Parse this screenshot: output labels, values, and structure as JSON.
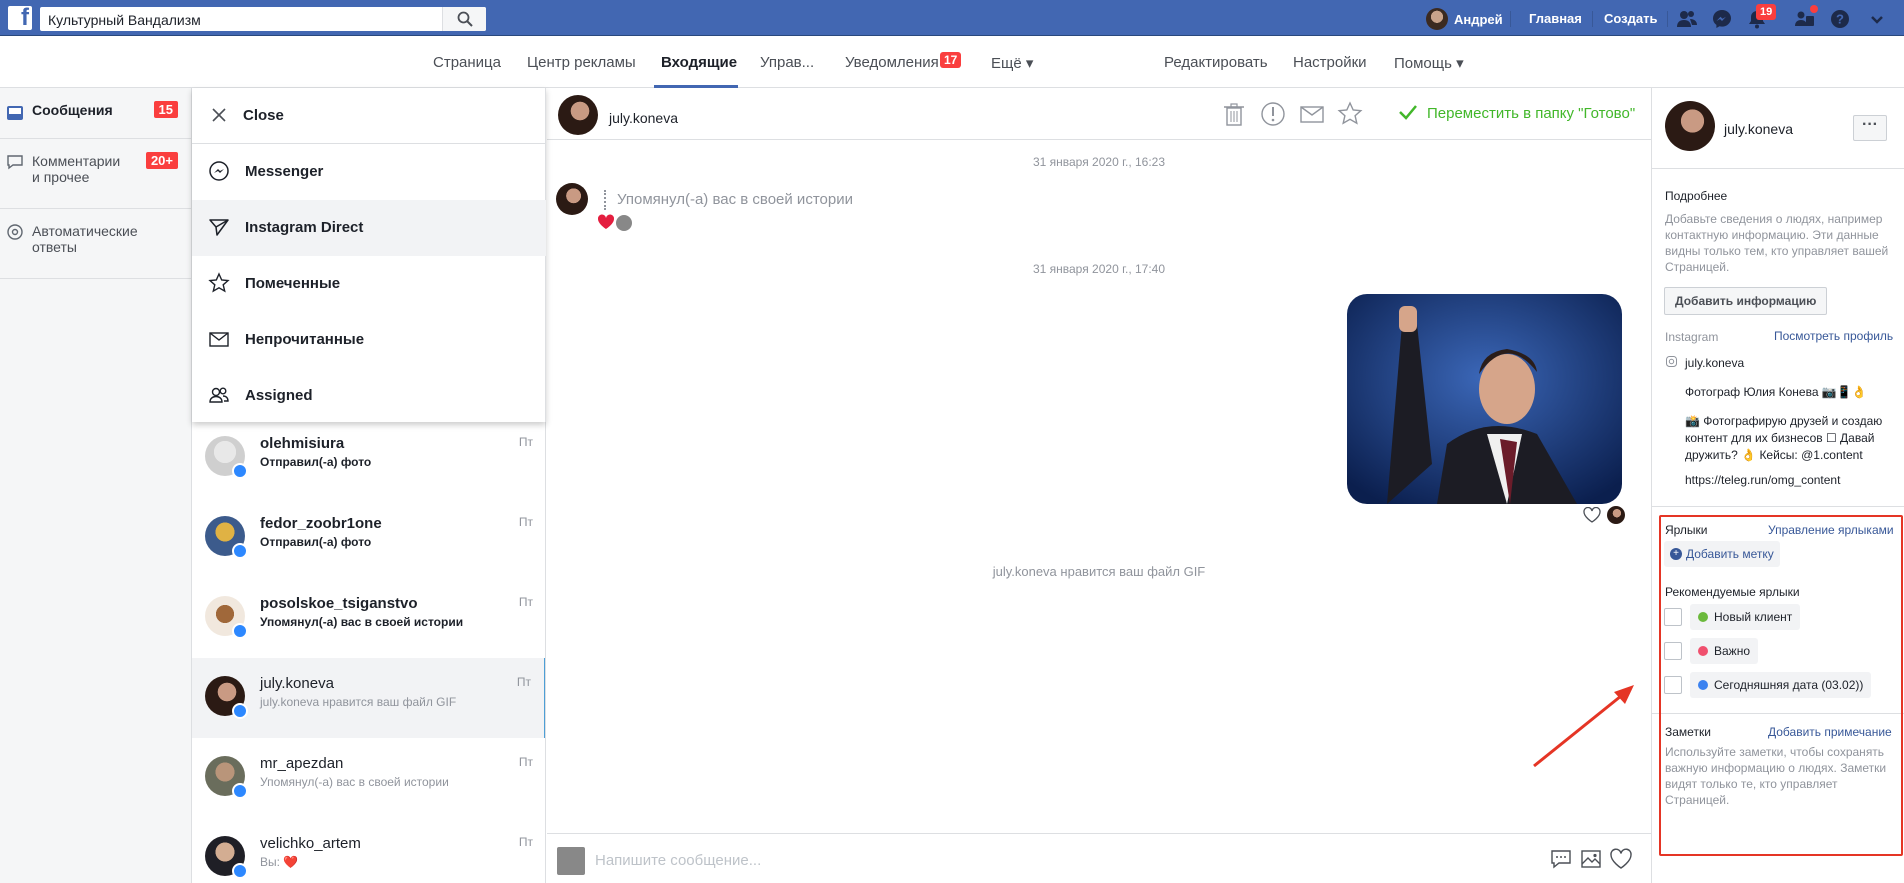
{
  "topbar": {
    "search_value": "Культурный Вандализм",
    "user_name": "Андрей",
    "home_label": "Главная",
    "create_label": "Создать",
    "notifications_count": "19"
  },
  "subnav": {
    "items": [
      "Страница",
      "Центр рекламы",
      "Входящие",
      "Управ...",
      "Уведомления",
      "Ещё ▾"
    ],
    "notifications_badge": "17",
    "right": [
      "Редактировать",
      "Настройки",
      "Помощь ▾"
    ]
  },
  "leftnav": {
    "items": [
      {
        "label": "Сообщения",
        "badge": "15"
      },
      {
        "label": "Комментарии и прочее",
        "badge": "20+"
      },
      {
        "label": "Автоматические ответы",
        "badge": ""
      }
    ]
  },
  "filter_menu": {
    "items": [
      "Close",
      "Messenger",
      "Instagram Direct",
      "Помеченные",
      "Непрочитанные",
      "Assigned"
    ]
  },
  "conversations": [
    {
      "name": "olehmisiura",
      "preview": "Отправил(-а) фото",
      "time": "Пт"
    },
    {
      "name": "fedor_zoobr1one",
      "preview": "Отправил(-а) фото",
      "time": "Пт"
    },
    {
      "name": "posolskoe_tsiganstvo",
      "preview": "Упомянул(-а) вас в своей истории",
      "time": "Пт"
    },
    {
      "name": "july.koneva",
      "preview": "july.koneva нравится ваш файл GIF",
      "time": "Пт"
    },
    {
      "name": "mr_apezdan",
      "preview": "Упомянул(-а) вас в своей истории",
      "time": "Пт"
    },
    {
      "name": "velichko_artem",
      "preview": "Вы: ❤️",
      "time": "Пт"
    }
  ],
  "chat": {
    "contact": "july.koneva",
    "move_to_done": "Переместить в папку \"Готово\"",
    "date1": "31 января 2020 г., 16:23",
    "mention_text": "Упомянул(-а) вас в своей истории",
    "date2": "31 января 2020 г., 17:40",
    "liked_text": "july.koneva нравится ваш файл GIF",
    "composer_placeholder": "Напишите сообщение..."
  },
  "rpanel": {
    "name": "july.koneva",
    "details_heading": "Подробнее",
    "details_text": "Добавьте сведения о людях, например контактную информацию. Эти данные видны только тем, кто управляет вашей Страницей.",
    "add_info_button": "Добавить информацию",
    "instagram_label": "Instagram",
    "view_profile": "Посмотреть профиль",
    "ig_handle": "july.koneva",
    "bio1": "Фотограф Юлия Конева 📷📱👌",
    "bio2": "📸 Фотографирую друзей и создаю контент для их бизнесов ☐ Давай дружить? 👌 Кейсы: @1.content",
    "bio3": "https://teleg.run/omg_content",
    "labels_heading": "Ярлыки",
    "manage_labels": "Управление ярлыками",
    "add_mark": "Добавить метку",
    "recommended": "Рекомендуемые ярлыки",
    "tags": [
      {
        "label": "Новый клиент",
        "color": "#6bb93c"
      },
      {
        "label": "Важно",
        "color": "#f0506e"
      },
      {
        "label": "Сегодняшняя дата (03.02))",
        "color": "#3b82f0"
      }
    ],
    "notes_heading": "Заметки",
    "add_note": "Добавить примечание",
    "notes_text": "Используйте заметки, чтобы сохранять важную информацию о людях. Заметки видят только те, кто управляет Страницей."
  },
  "colors": {
    "brand": "#4267b2",
    "accent_green": "#42b72a",
    "alert_red": "#fa3e3e",
    "annotation_red": "#e53525"
  }
}
